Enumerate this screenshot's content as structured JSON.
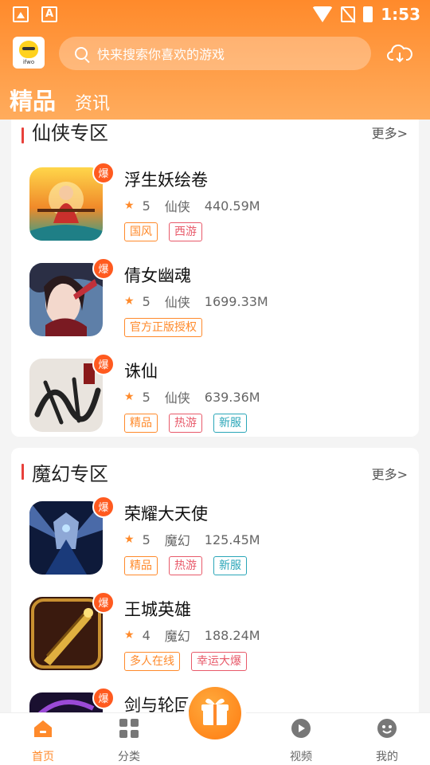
{
  "status": {
    "time": "1:53"
  },
  "logo_text": "ifwo",
  "search": {
    "placeholder": "快来搜索你喜欢的游戏"
  },
  "tabs": {
    "main": "精品",
    "sub": "资讯"
  },
  "sections": [
    {
      "title": "仙侠专区",
      "more": "更多>",
      "games": [
        {
          "name": "浮生妖绘卷",
          "rating": "5",
          "genre": "仙侠",
          "size": "440.59M",
          "badge": "爆",
          "tags": [
            "国风",
            "西游"
          ]
        },
        {
          "name": "倩女幽魂",
          "rating": "5",
          "genre": "仙侠",
          "size": "1699.33M",
          "badge": "爆",
          "tags": [
            "官方正版授权"
          ]
        },
        {
          "name": "诛仙",
          "rating": "5",
          "genre": "仙侠",
          "size": "639.36M",
          "badge": "爆",
          "tags": [
            "精品",
            "热游",
            "新服"
          ]
        }
      ]
    },
    {
      "title": "魔幻专区",
      "more": "更多>",
      "games": [
        {
          "name": "荣耀大天使",
          "rating": "5",
          "genre": "魔幻",
          "size": "125.45M",
          "badge": "爆",
          "tags": [
            "精品",
            "热游",
            "新服"
          ]
        },
        {
          "name": "王城英雄",
          "rating": "4",
          "genre": "魔幻",
          "size": "188.24M",
          "badge": "爆",
          "tags": [
            "多人在线",
            "幸运大爆"
          ]
        },
        {
          "name": "剑与轮回",
          "badge": "爆"
        }
      ]
    }
  ],
  "bottom_nav": [
    "首页",
    "分类",
    "视频",
    "我的"
  ],
  "colors": {
    "accent": "#ff8a2b",
    "header_end": "#ffac5d",
    "badge": "#ff5a1f",
    "section_bar": "#e8413b"
  }
}
